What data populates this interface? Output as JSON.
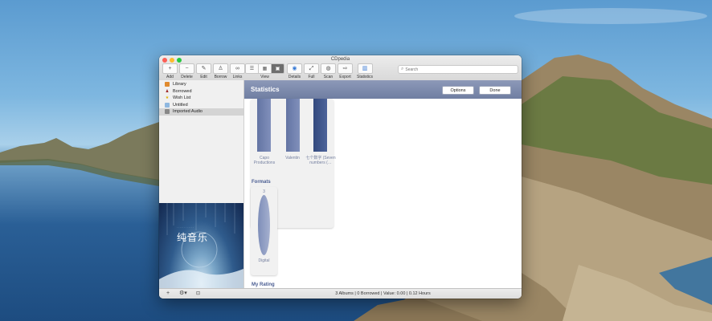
{
  "window": {
    "title": "CDpedia"
  },
  "toolbar": {
    "add": "Add",
    "delete": "Delete",
    "edit": "Edit",
    "borrow": "Borrow",
    "links": "Links",
    "view": "View",
    "details": "Details",
    "full": "Full",
    "scan": "Scan",
    "export": "Export",
    "statistics": "Statistics",
    "search_placeholder": "Search"
  },
  "sidebar": {
    "items": [
      {
        "label": "Library",
        "icon": "library-icon"
      },
      {
        "label": "Borrowed",
        "icon": "person-icon"
      },
      {
        "label": "Wish List",
        "icon": "star-icon"
      },
      {
        "label": "Untitled",
        "icon": "folder-icon"
      },
      {
        "label": "Imported Audio",
        "icon": "imported-audio-icon",
        "selected": true
      }
    ],
    "artwork_title": "纯音乐"
  },
  "main": {
    "title": "Statistics",
    "options_label": "Options",
    "done_label": "Done",
    "artists": {
      "labels": [
        "Capo Productions",
        "Valentin",
        "七个数字 (Seven numbers (…"
      ]
    },
    "formats": {
      "title": "Formats",
      "count": "3",
      "label": "Digital"
    },
    "rating_title": "My Rating"
  },
  "status": {
    "text": "3 Albums | 0 Borrowed | Value: 0.00 | 0.12 Hours"
  },
  "colors": {
    "accent": "#7280a6",
    "header": "#7c89ab",
    "window_bg": "#ffffff"
  }
}
